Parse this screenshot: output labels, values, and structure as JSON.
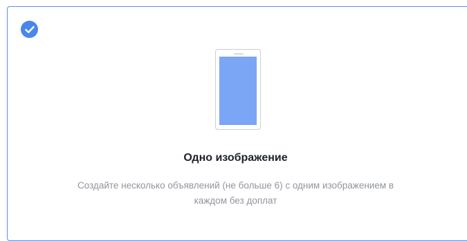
{
  "card": {
    "selected": true,
    "title": "Одно изображение",
    "description_line1": "Создайте несколько объявлений (не больше 6) с одним изображением в",
    "description_line2": "каждом без доплат"
  },
  "icons": {
    "check": "check-circle-icon",
    "device": "phone-icon"
  },
  "colors": {
    "accent": "#4a86ec",
    "card_border": "#5b8fe8",
    "screen": "#7aa6f5",
    "title_text": "#1d2129",
    "description_text": "#90949c"
  }
}
